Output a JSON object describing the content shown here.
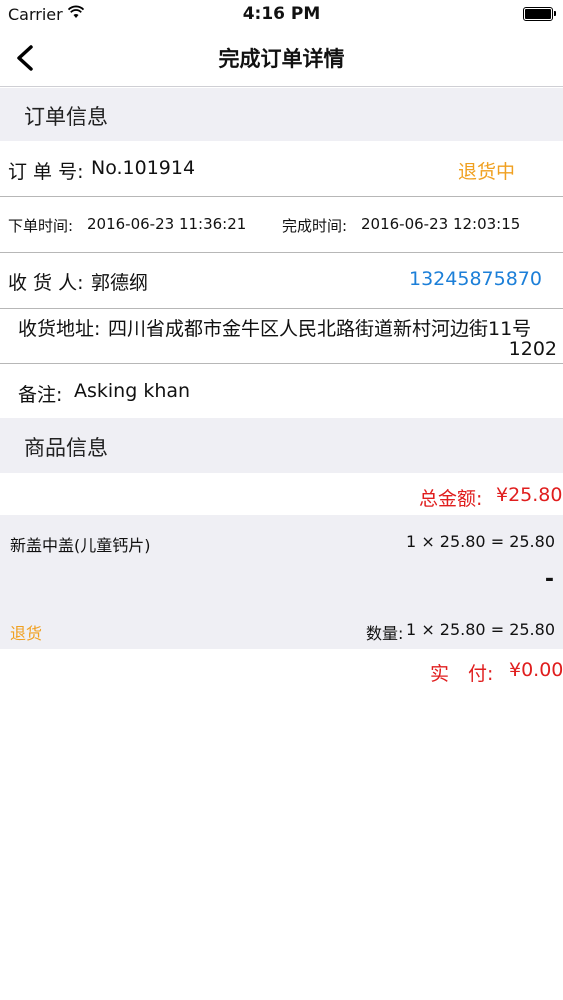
{
  "status_bar": {
    "carrier": "Carrier",
    "time": "4:16 PM"
  },
  "nav": {
    "title": "完成订单详情",
    "back_icon": "chevron-left-icon"
  },
  "order_section": {
    "title": "订单信息"
  },
  "order": {
    "number_label": "订 单 号:",
    "number_value": "No.101914",
    "status": "退货中",
    "order_time_label": "下单时间:",
    "order_time": "2016-06-23 11:36:21",
    "finish_time_label": "完成时间:",
    "finish_time": "2016-06-23 12:03:15",
    "receiver_label": "收 货 人:",
    "receiver_name": "郭德纲",
    "phone": "13245875870",
    "address_label": "收货地址:",
    "address_line1": "四川省成都市金牛区人民北路街道新村河边街11号",
    "address_line2": "1202",
    "remark_label": "备注:",
    "remark": "Asking khan"
  },
  "goods_section": {
    "title": "商品信息"
  },
  "goods": {
    "total_label": "总金额:",
    "total_value": "¥25.80",
    "item_name": "新盖中盖(儿童钙片)",
    "item_price_formula": "1 × 25.80 = 25.80",
    "item_dash": "-",
    "return_link": "退货",
    "quantity_label": "数量:",
    "quantity_formula": "1 × 25.80 = 25.80",
    "paid_label": "实　付:",
    "paid_value": "¥0.00"
  },
  "colors": {
    "accent_orange": "#f0a020",
    "phone_blue": "#1c7fd8",
    "price_red": "#e01e1e",
    "section_bg": "#efeff4"
  }
}
